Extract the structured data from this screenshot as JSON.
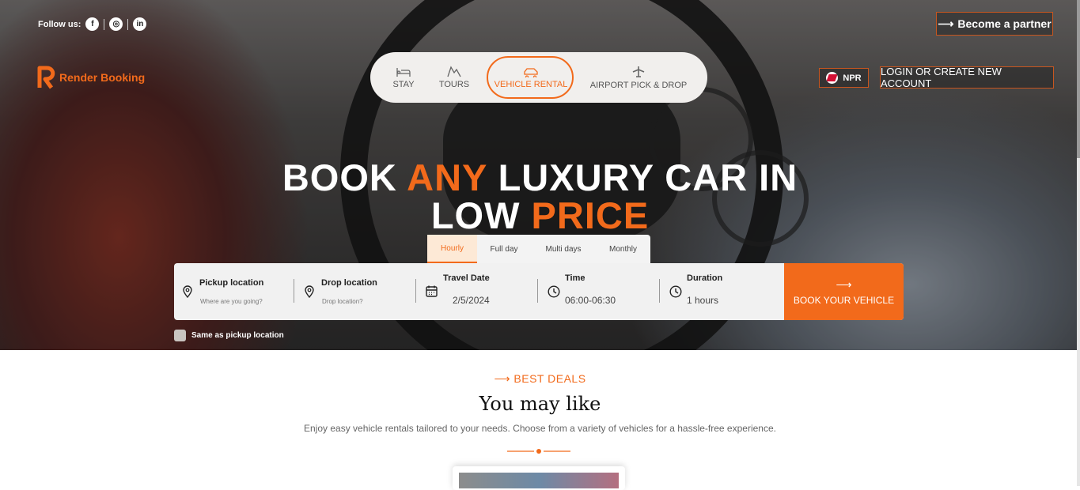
{
  "header": {
    "follow_label": "Follow us:",
    "socials": [
      "facebook-icon",
      "instagram-icon",
      "linkedin-icon"
    ],
    "partner_label": "Become a partner",
    "brand": "Render Booking",
    "currency": "NPR",
    "login_label": "LOGIN OR CREATE NEW ACCOUNT"
  },
  "nav": {
    "items": [
      {
        "label": "STAY",
        "icon": "bed-icon"
      },
      {
        "label": "TOURS",
        "icon": "mountain-icon"
      },
      {
        "label": "VEHICLE RENTAL",
        "icon": "car-icon"
      },
      {
        "label": "AIRPORT PICK & DROP",
        "icon": "plane-icon"
      }
    ],
    "active": "VEHICLE RENTAL"
  },
  "hero": {
    "line1_a": "BOOK",
    "line1_b": "ANY",
    "line1_c": "LUXURY CAR IN",
    "line2_a": "LOW",
    "line2_b": "PRICE"
  },
  "booking": {
    "tabs": [
      "Hourly",
      "Full day",
      "Multi days",
      "Monthly"
    ],
    "active_tab": "Hourly",
    "pickup": {
      "label": "Pickup location",
      "placeholder": "Where are you going?"
    },
    "drop": {
      "label": "Drop location",
      "placeholder": "Drop location?"
    },
    "date": {
      "label": "Travel Date",
      "value": "2/5/2024"
    },
    "time": {
      "label": "Time",
      "value": "06:00-06:30"
    },
    "duration": {
      "label": "Duration",
      "value": "1 hours"
    },
    "submit_label": "BOOK YOUR VEHICLE",
    "same_location_label": "Same as pickup location"
  },
  "deals": {
    "eyebrow": "BEST DEALS",
    "title": "You may like",
    "subtitle": "Enjoy easy vehicle rentals tailored to your needs. Choose from a variety of vehicles for a hassle-free experience."
  },
  "colors": {
    "accent": "#f26a1b",
    "nav_bg": "#f1efed"
  }
}
